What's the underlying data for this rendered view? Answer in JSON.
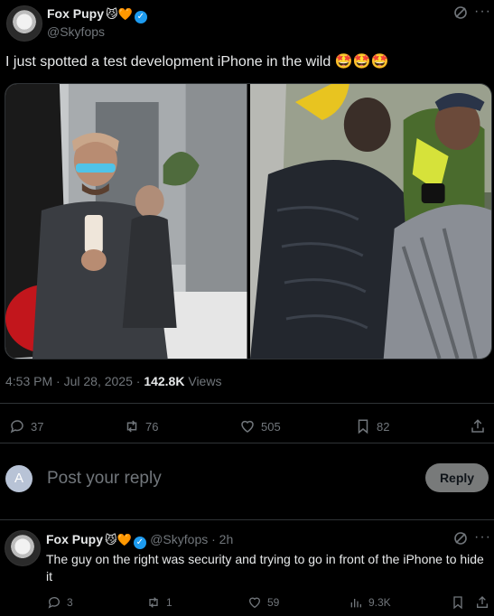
{
  "post": {
    "display_name": "Fox Pupy",
    "name_emojis": "😼🧡",
    "handle": "@Skyfops",
    "text": "I just spotted a test development iPhone in the wild 🤩🤩🤩",
    "time": "4:53 PM · Jul 28, 2025 · ",
    "views_count": "142.8K",
    "views_label": " Views",
    "more_icon": "ellipsis-icon",
    "grok_icon": "grok-icon",
    "media": [
      {
        "description": "Man in cap with sunglasses holding a phone",
        "colors": [
          "#2a2a2a",
          "#8a8f96",
          "#c9cfd4"
        ]
      },
      {
        "description": "Man in puffer vest near a tree",
        "colors": [
          "#1e2126",
          "#6d7a5a",
          "#c0d040"
        ]
      }
    ]
  },
  "actions": {
    "replies": "37",
    "reposts": "76",
    "likes": "505",
    "bookmarks": "82"
  },
  "compose": {
    "avatar_letter": "A",
    "placeholder": "Post your reply",
    "button": "Reply"
  },
  "reply": {
    "display_name": "Fox Pupy",
    "name_emojis": "😼🧡",
    "handle": "@Skyfops",
    "time": " · 2h",
    "text": "The guy on the right was security and trying to go in front of the iPhone to hide it",
    "replies": "3",
    "reposts": "1",
    "likes": "59",
    "views": "9.3K"
  },
  "colors": {
    "accent": "#1d9bf0",
    "muted": "#71767b",
    "text": "#e7e9ea",
    "divider": "#2f3336"
  }
}
